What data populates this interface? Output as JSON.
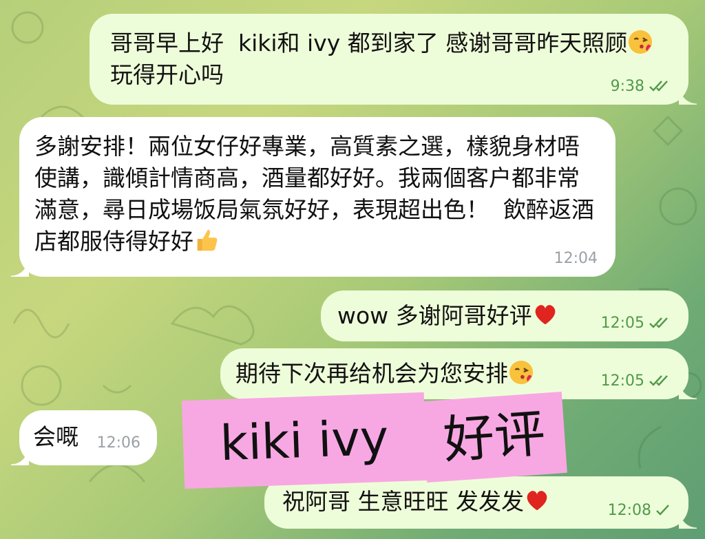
{
  "messages": [
    {
      "text": "哥哥早上好  kiki和 ivy 都到家了 感谢哥哥昨天照顾",
      "after_emoji_text": "玩得开心吗",
      "emoji": "kiss-face",
      "time": "9:38",
      "status": "read"
    },
    {
      "text": "多謝安排！兩位女仔好專業，高質素之選，樣貌身材唔使講，識傾計情商高，酒量都好好。我兩個客户都非常滿意，尋日成場饭局氣氛好好，表現超出色！  飲醉返酒店都服侍得好好",
      "emoji": "thumbs-up",
      "time": "12:04"
    },
    {
      "text": "wow 多谢阿哥好评",
      "emoji": "red-heart",
      "time": "12:05",
      "status": "read"
    },
    {
      "text": "期待下次再给机会为您安排",
      "emoji": "kiss-face",
      "time": "12:05",
      "status": "read"
    },
    {
      "text": "会嘅",
      "time": "12:06"
    },
    {
      "text": "祝阿哥 生意旺旺 发发发",
      "emoji": "red-heart",
      "time": "12:08",
      "status": "sent"
    }
  ],
  "sticker": {
    "part1": "kiki ivy",
    "part2": "好评",
    "color": "#f7a8e3"
  },
  "colors": {
    "outgoing": "#eefdd9",
    "incoming": "#ffffff",
    "meta_out": "#4f9a4a",
    "meta_in": "#9aa0a6"
  }
}
